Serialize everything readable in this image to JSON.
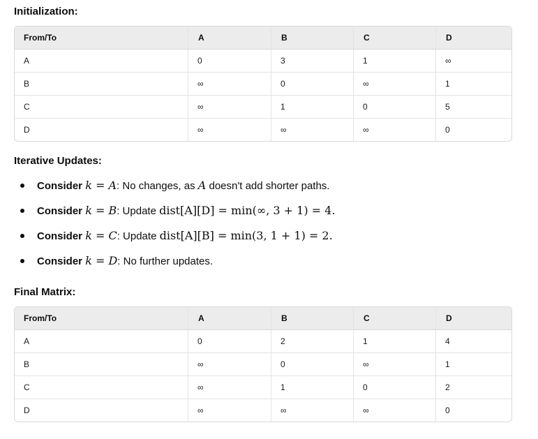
{
  "init_heading": "Initialization:",
  "init_table": {
    "headers": [
      "From/To",
      "A",
      "B",
      "C",
      "D"
    ],
    "rows": [
      [
        "A",
        "0",
        "3",
        "1",
        "∞"
      ],
      [
        "B",
        "∞",
        "0",
        "∞",
        "1"
      ],
      [
        "C",
        "∞",
        "1",
        "0",
        "5"
      ],
      [
        "D",
        "∞",
        "∞",
        "∞",
        "0"
      ]
    ]
  },
  "iter_heading": "Iterative Updates:",
  "updates": [
    {
      "lead": "Consider",
      "math": "k = A",
      "colon": ":",
      "text_before": " No changes, as ",
      "math2": "A",
      "text_after": " doesn't add shorter paths."
    },
    {
      "lead": "Consider",
      "math": "k = B",
      "colon": ":",
      "text_before": " Update ",
      "math2": "dist[A][D] = min(∞, 3 + 1) = 4.",
      "text_after": ""
    },
    {
      "lead": "Consider",
      "math": "k = C",
      "colon": ":",
      "text_before": " Update ",
      "math2": "dist[A][B] = min(3, 1 + 1) = 2.",
      "text_after": ""
    },
    {
      "lead": "Consider",
      "math": "k = D",
      "colon": ":",
      "text_before": " No further updates.",
      "math2": "",
      "text_after": ""
    }
  ],
  "final_heading": "Final Matrix:",
  "final_table": {
    "headers": [
      "From/To",
      "A",
      "B",
      "C",
      "D"
    ],
    "rows": [
      [
        "A",
        "0",
        "2",
        "1",
        "4"
      ],
      [
        "B",
        "∞",
        "0",
        "∞",
        "1"
      ],
      [
        "C",
        "∞",
        "1",
        "0",
        "2"
      ],
      [
        "D",
        "∞",
        "∞",
        "∞",
        "0"
      ]
    ]
  }
}
